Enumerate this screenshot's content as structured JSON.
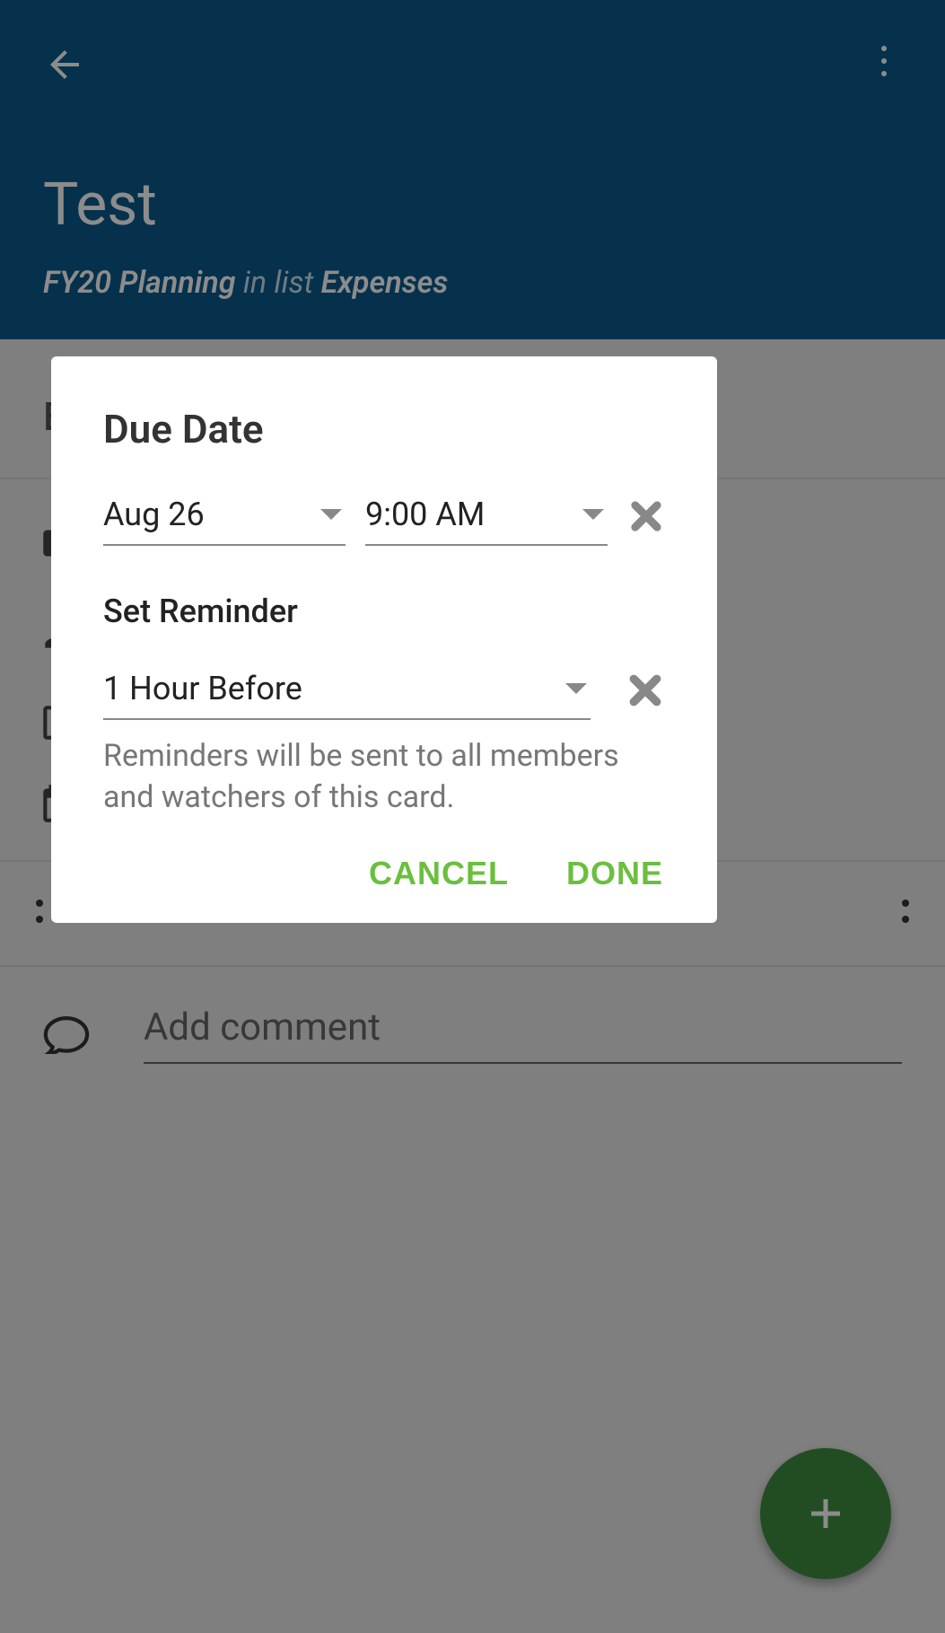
{
  "header": {
    "title": "Test",
    "board": "FY20 Planning",
    "in_list_text": "in list",
    "list": "Expenses"
  },
  "comment": {
    "placeholder": "Add comment"
  },
  "dialog": {
    "title": "Due Date",
    "date_value": "Aug 26",
    "time_value": "9:00 AM",
    "reminder_label": "Set Reminder",
    "reminder_value": "1 Hour Before",
    "helper_text": "Reminders will be sent to all members and watchers of this card.",
    "cancel_label": "CANCEL",
    "done_label": "DONE"
  },
  "bg_letter": "E"
}
